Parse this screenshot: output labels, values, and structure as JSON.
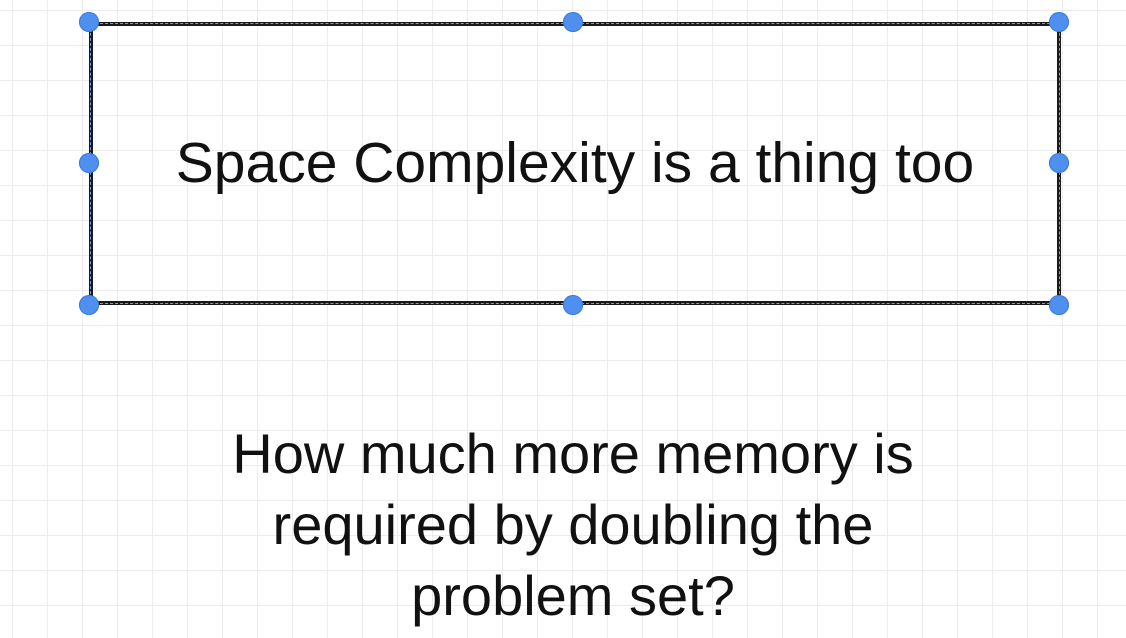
{
  "canvas": {
    "grid": true
  },
  "selected_shape": {
    "label": "Space Complexity is a thing too",
    "selected": true,
    "handles": [
      "top-left",
      "top-center",
      "top-right",
      "middle-left",
      "middle-right",
      "bottom-left",
      "bottom-center",
      "bottom-right"
    ],
    "colors": {
      "border": "#1a1a1a",
      "handle": "#4f8ff0"
    }
  },
  "question": {
    "lines": [
      "How much more memory is",
      "required by doubling the",
      "problem set?"
    ]
  }
}
